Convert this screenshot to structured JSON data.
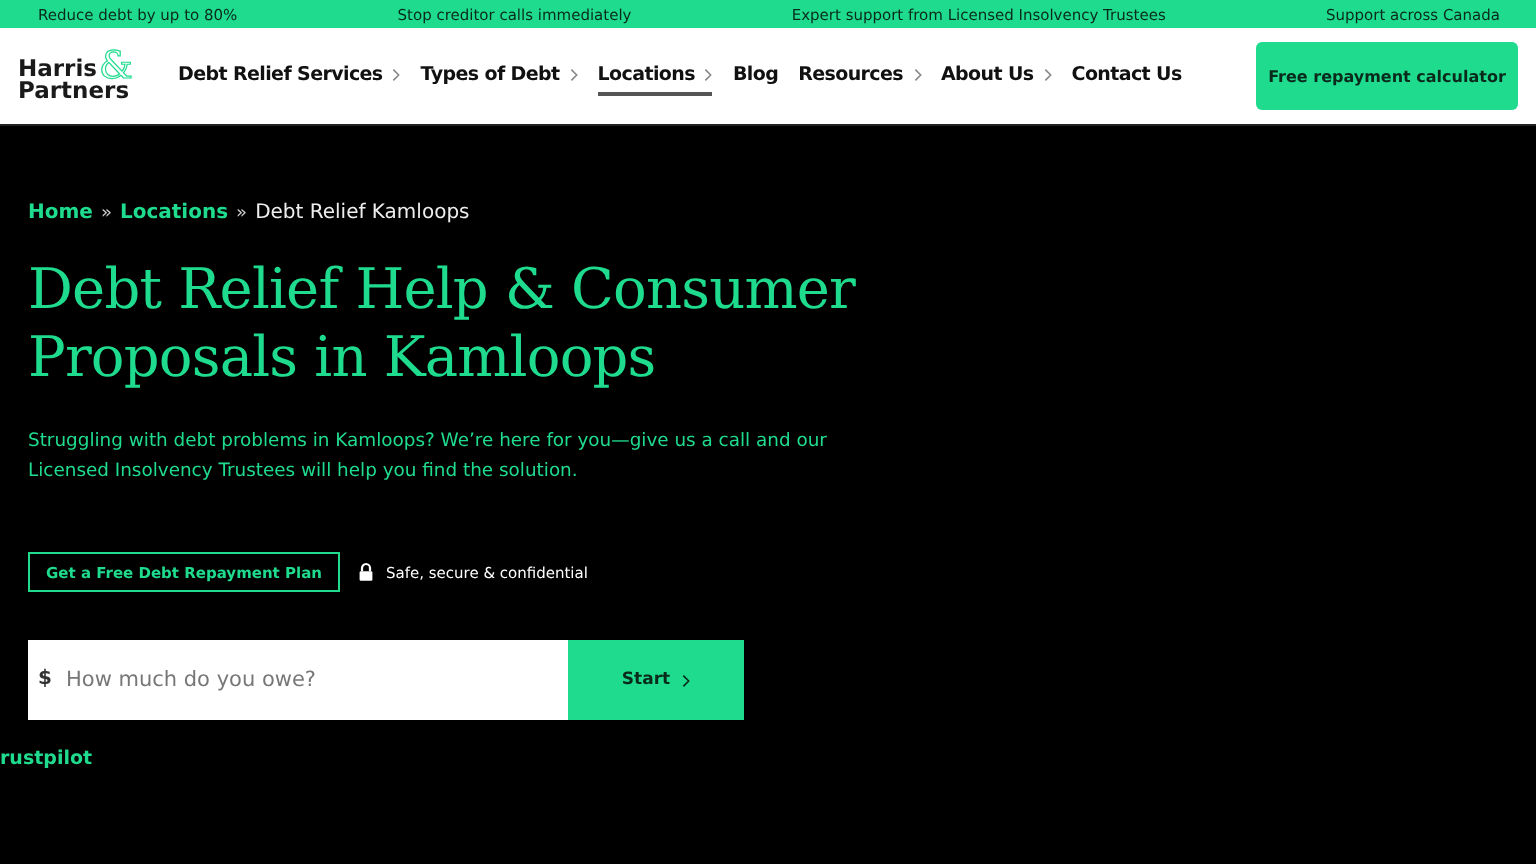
{
  "promo_bar": [
    "Reduce debt by up to 80%",
    "Stop creditor calls immediately",
    "Expert support from Licensed Insolvency Trustees",
    "Support across Canada"
  ],
  "logo": {
    "line_1": "Harris",
    "ampersand": "&",
    "line_2": "Partners"
  },
  "nav": [
    {
      "label": "Debt Relief Services",
      "has_submenu": true,
      "selected": false
    },
    {
      "label": "Types of Debt",
      "has_submenu": true,
      "selected": false
    },
    {
      "label": "Locations",
      "has_submenu": true,
      "selected": true
    },
    {
      "label": "Blog",
      "has_submenu": false,
      "selected": false
    },
    {
      "label": "Resources",
      "has_submenu": true,
      "selected": false
    },
    {
      "label": "About Us",
      "has_submenu": true,
      "selected": false
    },
    {
      "label": "Contact Us",
      "has_submenu": false,
      "selected": false
    }
  ],
  "header_button": "Free repayment calculator",
  "breadcrumb": [
    {
      "label": "Home",
      "link": true
    },
    {
      "label": "Locations",
      "link": true
    },
    {
      "label": "Debt Relief Kamloops",
      "link": false
    }
  ],
  "breadcrumb_separator": "»",
  "heading": "Debt Relief Help & Consumer Proposals in Kamloops",
  "intro": "Struggling with debt problems in Kamloops? We’re here for you—give us a call and our Licensed Insolvency Trustees will help you find the solution.",
  "plan_button": "Get a Free Debt Repayment Plan",
  "secure_note": "Safe, secure & confidential",
  "amount_form": {
    "currency": "$",
    "placeholder": "How much do you owe?",
    "button": "Start"
  },
  "trust_label": "rustpilot"
}
